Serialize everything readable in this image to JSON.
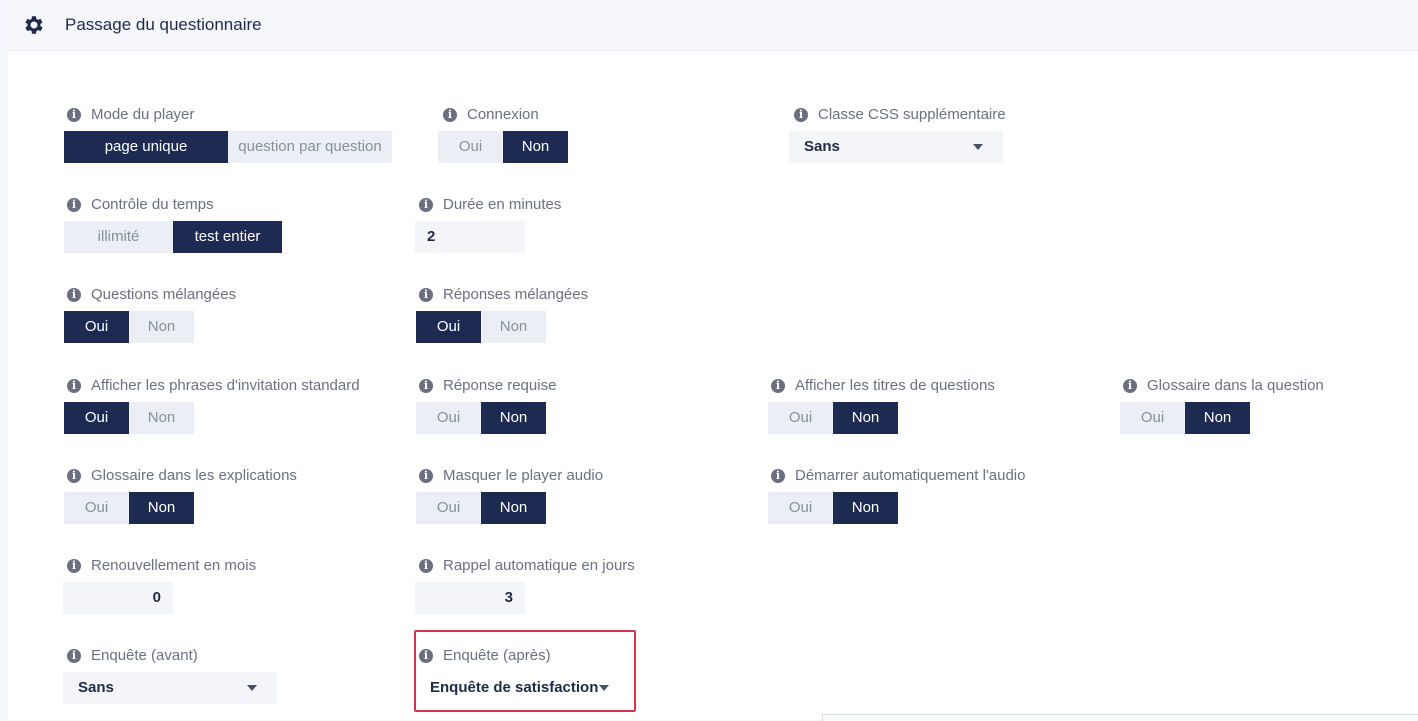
{
  "header": {
    "title": "Passage du questionnaire",
    "icon": "gear-icon"
  },
  "colors": {
    "active": "#1d2b52",
    "inactive": "#eceef5",
    "highlight": "#d9334a"
  },
  "fields": {
    "mode_player": {
      "label": "Mode du player",
      "options": [
        "page unique",
        "question par question"
      ],
      "selected": "page unique"
    },
    "connexion": {
      "label": "Connexion",
      "options": [
        "Oui",
        "Non"
      ],
      "selected": "Non"
    },
    "classe_css": {
      "label": "Classe CSS supplémentaire",
      "value": "Sans"
    },
    "controle_temps": {
      "label": "Contrôle du temps",
      "options": [
        "illimité",
        "test entier"
      ],
      "selected": "test entier"
    },
    "duree_minutes": {
      "label": "Durée en minutes",
      "value": "2"
    },
    "questions_melangees": {
      "label": "Questions mélangées",
      "options": [
        "Oui",
        "Non"
      ],
      "selected": "Oui"
    },
    "reponses_melangees": {
      "label": "Réponses mélangées",
      "options": [
        "Oui",
        "Non"
      ],
      "selected": "Oui"
    },
    "phrases_invitation": {
      "label": "Afficher les phrases d'invitation standard",
      "options": [
        "Oui",
        "Non"
      ],
      "selected": "Oui"
    },
    "reponse_requise": {
      "label": "Réponse requise",
      "options": [
        "Oui",
        "Non"
      ],
      "selected": "Non"
    },
    "titres_questions": {
      "label": "Afficher les titres de questions",
      "options": [
        "Oui",
        "Non"
      ],
      "selected": "Non"
    },
    "glossaire_question": {
      "label": "Glossaire dans la question",
      "options": [
        "Oui",
        "Non"
      ],
      "selected": "Non"
    },
    "glossaire_explications": {
      "label": "Glossaire dans les explications",
      "options": [
        "Oui",
        "Non"
      ],
      "selected": "Non"
    },
    "masquer_audio": {
      "label": "Masquer le player audio",
      "options": [
        "Oui",
        "Non"
      ],
      "selected": "Non"
    },
    "demarrer_audio": {
      "label": "Démarrer automatiquement l'audio",
      "options": [
        "Oui",
        "Non"
      ],
      "selected": "Non"
    },
    "renouvellement": {
      "label": "Renouvellement en mois",
      "value": "0"
    },
    "rappel": {
      "label": "Rappel automatique en jours",
      "value": "3"
    },
    "enquete_avant": {
      "label": "Enquête (avant)",
      "value": "Sans"
    },
    "enquete_apres": {
      "label": "Enquête (après)",
      "value": "Enquête de satisfaction"
    }
  }
}
